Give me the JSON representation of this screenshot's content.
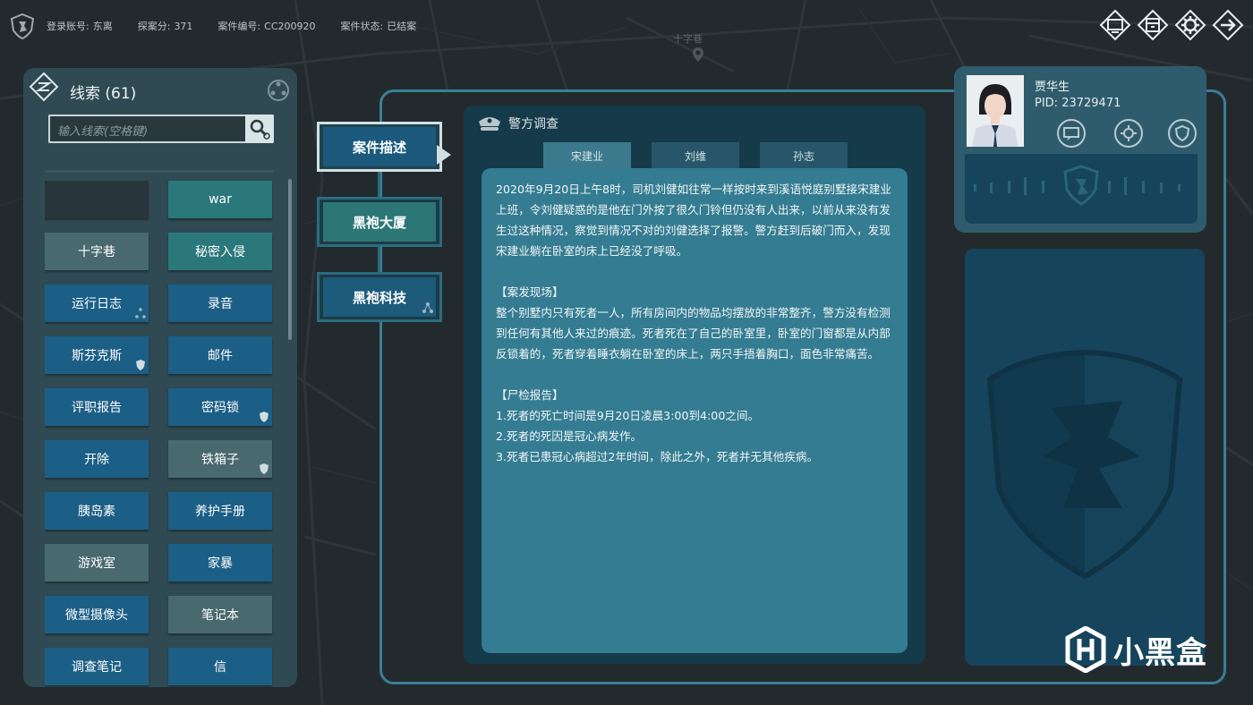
{
  "status": {
    "account_label": "登录账号:",
    "account": "东离",
    "score_label": "探案分:",
    "score": "371",
    "case_label": "案件编号:",
    "case_no": "CC200920",
    "state_label": "案件状态:",
    "state": "已结案"
  },
  "map": {
    "street_label": "十字巷"
  },
  "top_icons": [
    "screen-icon",
    "archive-icon",
    "settings-gear-icon",
    "exit-icon"
  ],
  "clues": {
    "title": "线索",
    "count": "(61)",
    "search_placeholder": "输入线索(空格键)",
    "items": [
      {
        "label": "",
        "style": "dark"
      },
      {
        "label": "war",
        "style": "teal"
      },
      {
        "label": "十字巷",
        "style": "gray"
      },
      {
        "label": "秘密入侵",
        "style": "teal"
      },
      {
        "label": "运行日志",
        "style": "blue",
        "badge": "network-icon"
      },
      {
        "label": "录音",
        "style": "blue"
      },
      {
        "label": "斯芬克斯",
        "style": "blue",
        "badge": "shield-icon"
      },
      {
        "label": "邮件",
        "style": "blue"
      },
      {
        "label": "评职报告",
        "style": "blue"
      },
      {
        "label": "密码锁",
        "style": "blue",
        "badge": "shield-icon"
      },
      {
        "label": "开除",
        "style": "blue"
      },
      {
        "label": "铁箱子",
        "style": "gray",
        "badge": "shield-icon"
      },
      {
        "label": "胰岛素",
        "style": "blue"
      },
      {
        "label": "养护手册",
        "style": "blue"
      },
      {
        "label": "游戏室",
        "style": "gray"
      },
      {
        "label": "家暴",
        "style": "blue"
      },
      {
        "label": "微型摄像头",
        "style": "blue"
      },
      {
        "label": "笔记本",
        "style": "gray"
      },
      {
        "label": "调查笔记",
        "style": "blue"
      },
      {
        "label": "信",
        "style": "blue"
      }
    ]
  },
  "side_tabs": [
    {
      "label": "案件描述",
      "active": true
    },
    {
      "label": "黑袍大厦",
      "active": false
    },
    {
      "label": "黑袍科技",
      "active": false,
      "badge": "network-icon"
    }
  ],
  "police": {
    "title": "警方调查",
    "tabs": [
      "宋建业",
      "刘维",
      "孙志"
    ],
    "active_tab": 0,
    "paragraphs": [
      "2020年9月20日上午8时，司机刘健如往常一样按时来到溪语悦庭别墅接宋建业上班，令刘健疑惑的是他在门外按了很久门铃但仍没有人出来，以前从来没有发生过这种情况，察觉到情况不对的刘健选择了报警。警方赶到后破门而入，发现宋建业躺在卧室的床上已经没了呼吸。",
      "【案发现场】\n整个别墅内只有死者一人，所有房间内的物品均摆放的非常整齐，警方没有检测到任何有其他人来过的痕迹。死者死在了自己的卧室里，卧室的门窗都是从内部反锁着的，死者穿着睡衣躺在卧室的床上，两只手捂着胸口，面色非常痛苦。",
      "【尸检报告】\n1.死者的死亡时间是9月20日凌晨3:00到4:00之间。\n2.死者的死因是冠心病发作。\n3.死者已患冠心病超过2年时间，除此之外，死者并无其他疾病。"
    ]
  },
  "profile": {
    "name": "贾华生",
    "pid": "PID: 23729471",
    "icons": [
      "chat-icon",
      "settings-gear-icon",
      "shield-icon"
    ]
  },
  "watermark": {
    "text": "小黑盒"
  },
  "colors": {
    "background": "#232a2e",
    "panel": "#2f4a52",
    "tile_blue": "#1c5f86",
    "tile_teal": "#2a787a",
    "tile_gray": "#48696e",
    "frame_border": "#3a7f96",
    "description_bg": "#347c91"
  }
}
